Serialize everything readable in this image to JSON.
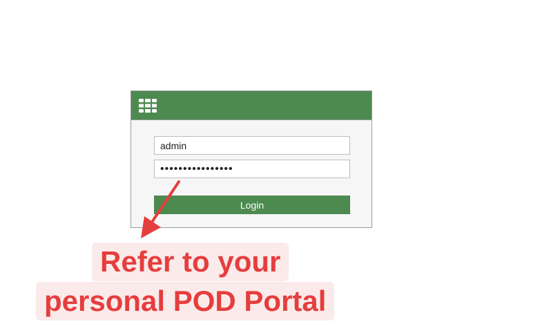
{
  "login": {
    "username_value": "admin",
    "password_value": "••••••••••••••••",
    "login_label": "Login"
  },
  "annotation": {
    "line1": "Refer to your",
    "line2": "personal POD Portal"
  },
  "icons": {
    "logo": "fortinet-logo-icon",
    "arrow": "red-arrow-icon"
  },
  "colors": {
    "header_green": "#4c8a50",
    "button_green": "#4c8a50",
    "annotation_red": "#e63d3d",
    "annotation_bg": "#fbeaea"
  }
}
